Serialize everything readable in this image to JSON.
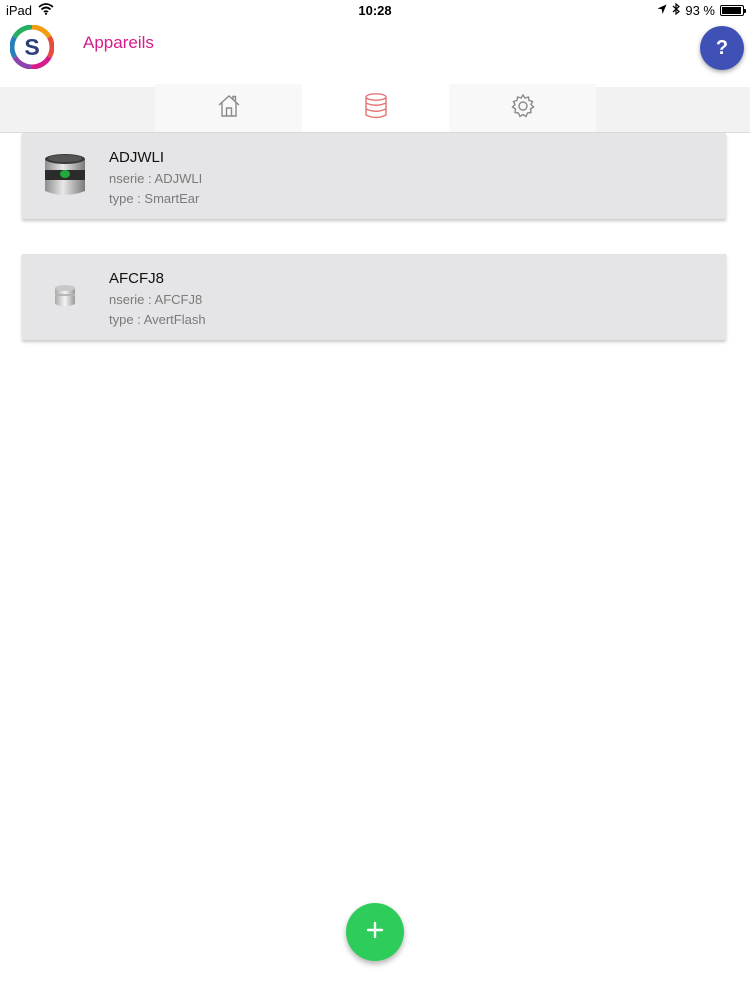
{
  "status_bar": {
    "device": "iPad",
    "time": "10:28",
    "battery": "93 %",
    "battery_level": 0.93,
    "icons": [
      "wifi-icon",
      "location-arrow-icon",
      "bluetooth-icon",
      "battery-icon"
    ]
  },
  "header": {
    "logo_letter": "S",
    "title": "Appareils",
    "title_color": "#d81b8a",
    "help_label": "?",
    "help_color": "#3f51b5"
  },
  "tabs": [
    {
      "name": "home",
      "icon": "home-icon",
      "active": false
    },
    {
      "name": "devices",
      "icon": "database-icon",
      "active": true
    },
    {
      "name": "settings",
      "icon": "gear-icon",
      "active": false
    }
  ],
  "devices": [
    {
      "name": "ADJWLI",
      "serial": "nserie : ADJWLI",
      "type": "type : SmartEar",
      "icon": "smartear-device-icon"
    },
    {
      "name": "AFCFJ8",
      "serial": "nserie : AFCFJ8",
      "type": "type : AvertFlash",
      "icon": "avertflash-device-icon"
    }
  ],
  "fab": {
    "label": "+",
    "icon": "plus-icon",
    "color": "#2ecc5a"
  }
}
